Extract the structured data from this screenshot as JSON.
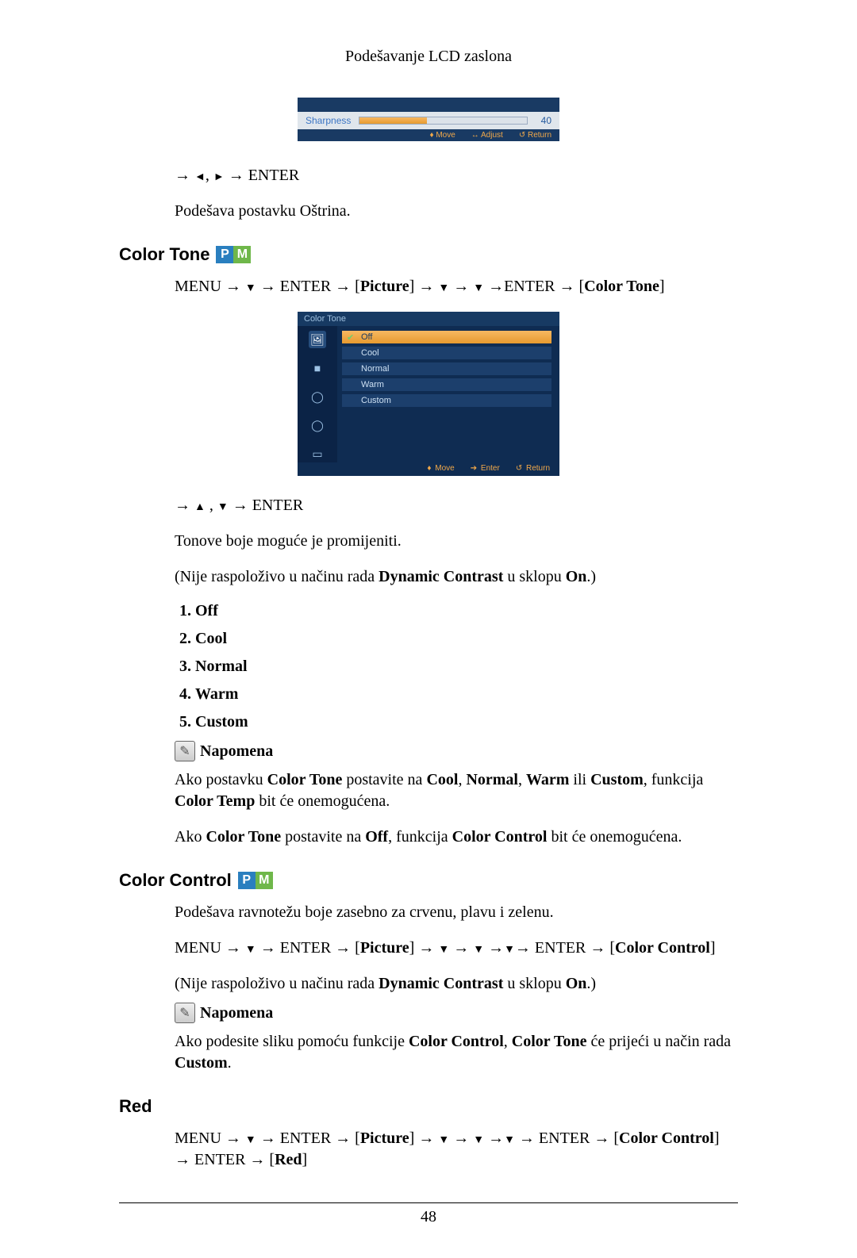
{
  "header": "Podešavanje LCD zaslona",
  "chart_data": {
    "type": "bar",
    "categories": [
      "Sharpness"
    ],
    "values": [
      40
    ],
    "title": "",
    "xlabel": "",
    "ylabel": "",
    "ylim": [
      0,
      100
    ]
  },
  "osd_sharpness": {
    "label": "Sharpness",
    "value": "40",
    "move": "Move",
    "adjust": "Adjust",
    "return": "Return"
  },
  "sharpness_nav": {
    "arrow": "→ ",
    "mid": ", ",
    "tail": " → ENTER"
  },
  "sharpness_desc": "Podešava postavku Oštrina.",
  "color_tone_heading": "Color Tone",
  "pm": {
    "p": "P",
    "m": "M"
  },
  "color_tone_path": {
    "pre": "MENU → ",
    "enter1": " → ENTER → [",
    "picture": "Picture",
    "mid1": "] → ",
    "mid2": " → ",
    "enter2": " →ENTER → [",
    "colortone": "Color Tone",
    "end": "]"
  },
  "osd_colortone": {
    "title": "Color Tone",
    "items": [
      "Off",
      "Cool",
      "Normal",
      "Warm",
      "Custom"
    ],
    "move": "Move",
    "enter": "Enter",
    "return": "Return"
  },
  "ct_nav": {
    "arrow": "→ ",
    "mid": " , ",
    "tail": " → ENTER"
  },
  "ct_desc": "Tonove boje moguće je promijeniti.",
  "ct_note_dc_pre": "(Nije raspoloživo u načinu rada ",
  "ct_note_dc_bold": "Dynamic Contrast",
  "ct_note_dc_mid": " u sklopu ",
  "ct_note_dc_on": "On",
  "ct_note_dc_end": ".)",
  "ct_list": [
    "Off",
    "Cool",
    "Normal",
    "Warm",
    "Custom"
  ],
  "napomena_label": "Napomena",
  "ct_napomena1_pre": "Ako postavku ",
  "ct_napomena1_b1": "Color Tone",
  "ct_napomena1_mid1": " postavite na ",
  "ct_napomena1_b2": "Cool",
  "ct_napomena1_c1": ", ",
  "ct_napomena1_b3": "Normal",
  "ct_napomena1_c2": ", ",
  "ct_napomena1_b4": "Warm",
  "ct_napomena1_or": " ili ",
  "ct_napomena1_b5": "Custom",
  "ct_napomena1_mid2": ", funkcija ",
  "ct_napomena1_b6": "Color Temp",
  "ct_napomena1_end": " bit će onemogućena.",
  "ct_napomena2_pre": "Ako ",
  "ct_napomena2_b1": "Color Tone",
  "ct_napomena2_mid1": " postavite na ",
  "ct_napomena2_b2": "Off",
  "ct_napomena2_mid2": ", funkcija ",
  "ct_napomena2_b3": "Color Control",
  "ct_napomena2_end": " bit će onemogućena.",
  "color_control_heading": "Color Control",
  "cc_desc": "Podešava ravnotežu boje zasebno za crvenu, plavu i zelenu.",
  "cc_path": {
    "pre": "MENU → ",
    "enter1": " → ENTER → [",
    "picture": "Picture",
    "mid1": "] → ",
    "mid2": " → ",
    "mid3": " →",
    "enter2": "→ ENTER → [",
    "cc": "Color Control",
    "end": "]"
  },
  "cc_napomena_pre": "Ako podesite sliku pomoću funkcije ",
  "cc_napomena_b1": "Color Control",
  "cc_napomena_mid1": ", ",
  "cc_napomena_b2": "Color Tone",
  "cc_napomena_mid2": " će prijeći u način rada ",
  "cc_napomena_b3": "Custom",
  "cc_napomena_end": ".",
  "red_heading": "Red",
  "red_path": {
    "pre": "MENU → ",
    "enter1": " → ENTER → [",
    "picture": "Picture",
    "mid1": "] → ",
    "mid2": " → ",
    "mid3": " →",
    "mid4": " → ENTER → [",
    "cc": "Color Control",
    "mid5": "] → ENTER → [",
    "red": "Red",
    "end": "]"
  },
  "pagenum": "48"
}
